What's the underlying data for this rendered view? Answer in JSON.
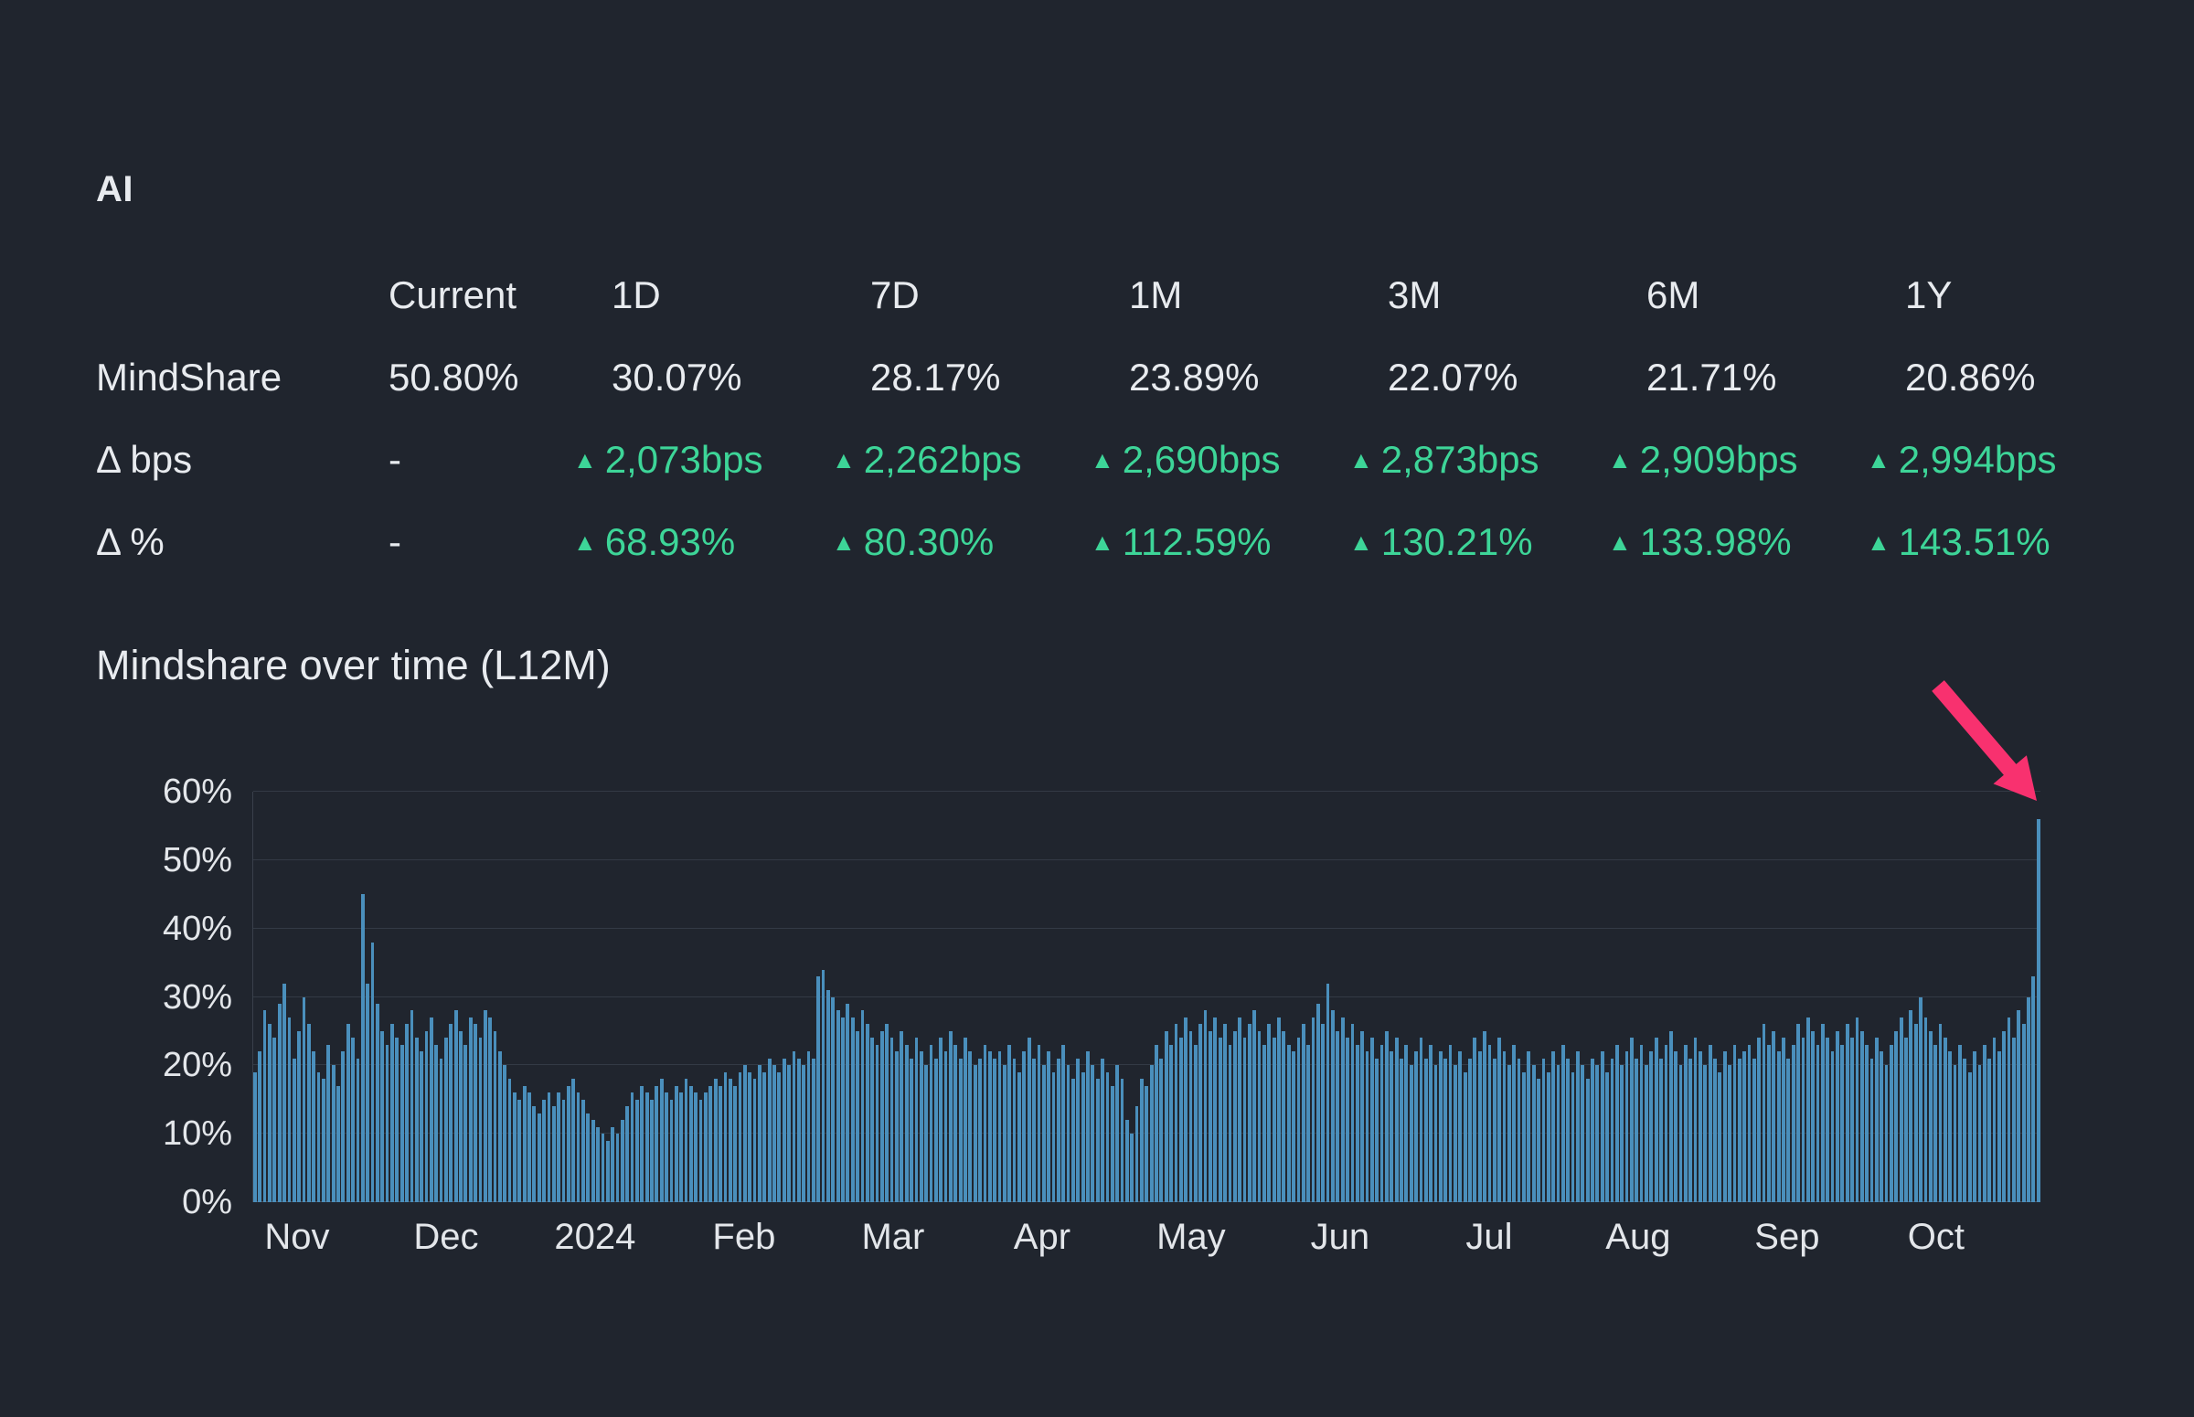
{
  "page": {
    "title": "AI"
  },
  "stats": {
    "columns": [
      "Current",
      "1D",
      "7D",
      "1M",
      "3M",
      "6M",
      "1Y"
    ],
    "up_arrow": "▲",
    "rows": [
      {
        "label": "MindShare",
        "values": [
          "50.80%",
          "30.07%",
          "28.17%",
          "23.89%",
          "22.07%",
          "21.71%",
          "20.86%"
        ]
      },
      {
        "label": "Δ bps",
        "values": [
          "-",
          "2,073bps",
          "2,262bps",
          "2,690bps",
          "2,873bps",
          "2,909bps",
          "2,994bps"
        ]
      },
      {
        "label": "Δ %",
        "values": [
          "-",
          "68.93%",
          "80.30%",
          "112.59%",
          "130.21%",
          "133.98%",
          "143.51%"
        ]
      }
    ]
  },
  "chart_data": {
    "type": "bar",
    "title": "Mindshare over time (L12M)",
    "unit": "%",
    "ylim": [
      0,
      60
    ],
    "y_ticks": [
      0,
      10,
      20,
      30,
      40,
      50,
      60
    ],
    "x_labels": [
      "Nov",
      "Dec",
      "2024",
      "Feb",
      "Mar",
      "Apr",
      "May",
      "Jun",
      "Jul",
      "Aug",
      "Sep",
      "Oct"
    ],
    "bar_color": "#4a8fbc",
    "grid_on": true,
    "legend": "none",
    "values": [
      19,
      22,
      28,
      26,
      24,
      29,
      32,
      27,
      21,
      25,
      30,
      26,
      22,
      19,
      18,
      23,
      20,
      17,
      22,
      26,
      24,
      21,
      45,
      32,
      38,
      29,
      25,
      23,
      26,
      24,
      23,
      26,
      28,
      24,
      22,
      25,
      27,
      23,
      21,
      24,
      26,
      28,
      25,
      23,
      27,
      26,
      24,
      28,
      27,
      25,
      22,
      20,
      18,
      16,
      15,
      17,
      16,
      14,
      13,
      15,
      16,
      14,
      16,
      15,
      17,
      18,
      16,
      15,
      13,
      12,
      11,
      10,
      9,
      11,
      10,
      12,
      14,
      16,
      15,
      17,
      16,
      15,
      17,
      18,
      16,
      15,
      17,
      16,
      18,
      17,
      16,
      15,
      16,
      17,
      18,
      17,
      19,
      18,
      17,
      19,
      20,
      19,
      18,
      20,
      19,
      21,
      20,
      19,
      21,
      20,
      22,
      21,
      20,
      22,
      21,
      33,
      34,
      31,
      30,
      28,
      27,
      29,
      27,
      25,
      28,
      26,
      24,
      23,
      25,
      26,
      24,
      22,
      25,
      23,
      21,
      24,
      22,
      20,
      23,
      21,
      24,
      22,
      25,
      23,
      21,
      24,
      22,
      20,
      21,
      23,
      22,
      21,
      22,
      20,
      23,
      21,
      19,
      22,
      24,
      21,
      23,
      20,
      22,
      19,
      21,
      23,
      20,
      18,
      21,
      19,
      22,
      20,
      18,
      21,
      19,
      17,
      20,
      18,
      12,
      10,
      14,
      18,
      17,
      20,
      23,
      21,
      25,
      23,
      26,
      24,
      27,
      25,
      23,
      26,
      28,
      25,
      27,
      24,
      26,
      23,
      25,
      27,
      24,
      26,
      28,
      25,
      23,
      26,
      24,
      27,
      25,
      23,
      22,
      24,
      26,
      23,
      27,
      29,
      26,
      32,
      28,
      25,
      27,
      24,
      26,
      23,
      25,
      22,
      24,
      21,
      23,
      25,
      22,
      24,
      21,
      23,
      20,
      22,
      24,
      21,
      23,
      20,
      22,
      21,
      23,
      20,
      22,
      19,
      21,
      24,
      22,
      25,
      23,
      21,
      24,
      22,
      20,
      23,
      21,
      19,
      22,
      20,
      18,
      21,
      19,
      22,
      20,
      23,
      21,
      19,
      22,
      20,
      18,
      21,
      20,
      22,
      19,
      21,
      23,
      20,
      22,
      24,
      21,
      23,
      20,
      22,
      24,
      21,
      23,
      25,
      22,
      20,
      23,
      21,
      24,
      22,
      20,
      23,
      21,
      19,
      22,
      20,
      23,
      21,
      22,
      23,
      21,
      24,
      26,
      23,
      25,
      22,
      24,
      21,
      23,
      26,
      24,
      27,
      25,
      23,
      26,
      24,
      22,
      25,
      23,
      26,
      24,
      27,
      25,
      23,
      21,
      24,
      22,
      20,
      23,
      25,
      27,
      24,
      28,
      26,
      30,
      27,
      25,
      23,
      26,
      24,
      22,
      20,
      23,
      21,
      19,
      22,
      20,
      23,
      21,
      24,
      22,
      25,
      27,
      24,
      28,
      26,
      30,
      33,
      56
    ]
  },
  "annotation": {
    "color": "#f8316f"
  },
  "colors": {
    "background": "#20252e",
    "text": "#e8ebef",
    "positive": "#3dd598",
    "bar": "#4a8fbc",
    "grid": "#333a45",
    "arrow": "#f8316f"
  }
}
